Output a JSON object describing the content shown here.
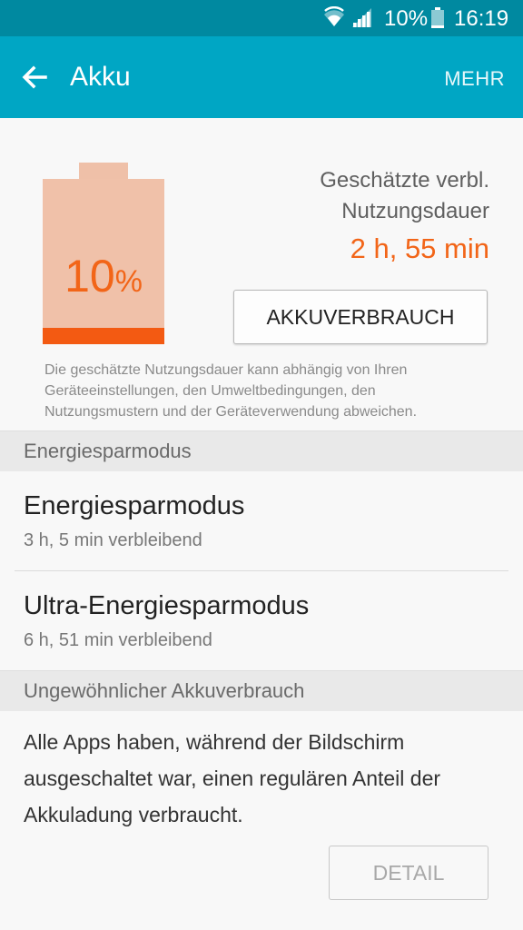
{
  "status_bar": {
    "battery_percent": "10%",
    "time": "16:19"
  },
  "app_bar": {
    "title": "Akku",
    "more_label": "MEHR"
  },
  "battery": {
    "level_percent": 10,
    "percent_number": "10",
    "percent_unit": "%"
  },
  "estimate": {
    "label_line1": "Geschätzte verbl.",
    "label_line2": "Nutzungsdauer",
    "value": "2 h, 55 min"
  },
  "usage_button": "AKKUVERBRAUCH",
  "disclaimer": "Die geschätzte Nutzungsdauer kann abhängig von Ihren Geräteeinstellungen, den Umweltbedingungen, den Nutzungsmustern und der Geräteverwendung abweichen.",
  "sections": {
    "power_saving": {
      "header": "Energiesparmodus",
      "items": [
        {
          "title": "Energiesparmodus",
          "subtitle": "3 h, 5 min verbleibend"
        },
        {
          "title": "Ultra-Energiesparmodus",
          "subtitle": "6 h, 51 min verbleibend"
        }
      ]
    },
    "unusual_usage": {
      "header": "Ungewöhnlicher Akkuverbrauch",
      "text": "Alle Apps haben, während der Bildschirm ausgeschaltet war, einen regulären Anteil der Akkuladung verbraucht.",
      "detail_button": "DETAIL"
    }
  },
  "icons": [
    "wifi-icon",
    "signal-icon",
    "battery-status-icon",
    "back-arrow-icon"
  ],
  "colors": {
    "status_bar": "#0089a0",
    "app_bar": "#00a6c4",
    "accent_orange": "#f26518",
    "battery_body": "#f0c1a9"
  }
}
